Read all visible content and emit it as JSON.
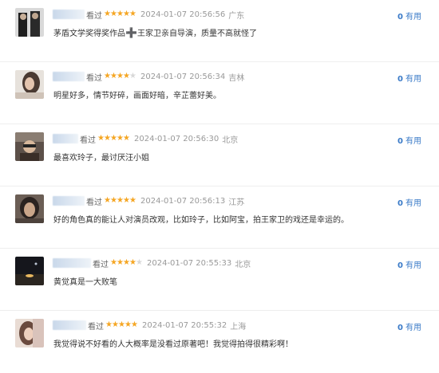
{
  "ui": {
    "star_glyph": "★",
    "useful_label": "有用"
  },
  "colors": {
    "star": "#f5a623",
    "link": "#3b7bc8",
    "muted": "#999999"
  },
  "comments": [
    {
      "watched": "看过",
      "rating": 5,
      "time": "2024-01-07 20:56:56",
      "location": "广东",
      "text_before": "茅盾文学奖得奖作品",
      "plus": "➕",
      "text_after": "王家卫亲自导演，质量不高就怪了",
      "useful_count": "0"
    },
    {
      "watched": "看过",
      "rating": 4,
      "time": "2024-01-07 20:56:34",
      "location": "吉林",
      "text": "明星好多，情节好碎，画面好暗，辛芷蕾好美。",
      "useful_count": "0"
    },
    {
      "watched": "看过",
      "rating": 5,
      "time": "2024-01-07 20:56:30",
      "location": "北京",
      "text": "最喜欢玲子，最讨厌汪小姐",
      "useful_count": "0"
    },
    {
      "watched": "看过",
      "rating": 5,
      "time": "2024-01-07 20:56:13",
      "location": "江苏",
      "text": "好的角色真的能让人对演员改观，比如玲子，比如阿宝，拍王家卫的戏还是幸运的。",
      "useful_count": "0"
    },
    {
      "watched": "看过",
      "rating": 4,
      "time": "2024-01-07 20:55:33",
      "location": "北京",
      "text": "黄觉真是一大败笔",
      "useful_count": "0"
    },
    {
      "watched": "看过",
      "rating": 5,
      "time": "2024-01-07 20:55:32",
      "location": "上海",
      "text": "我觉得说不好看的人大概率是没看过原著吧！我觉得拍得很精彩啊！",
      "useful_count": "0"
    }
  ]
}
